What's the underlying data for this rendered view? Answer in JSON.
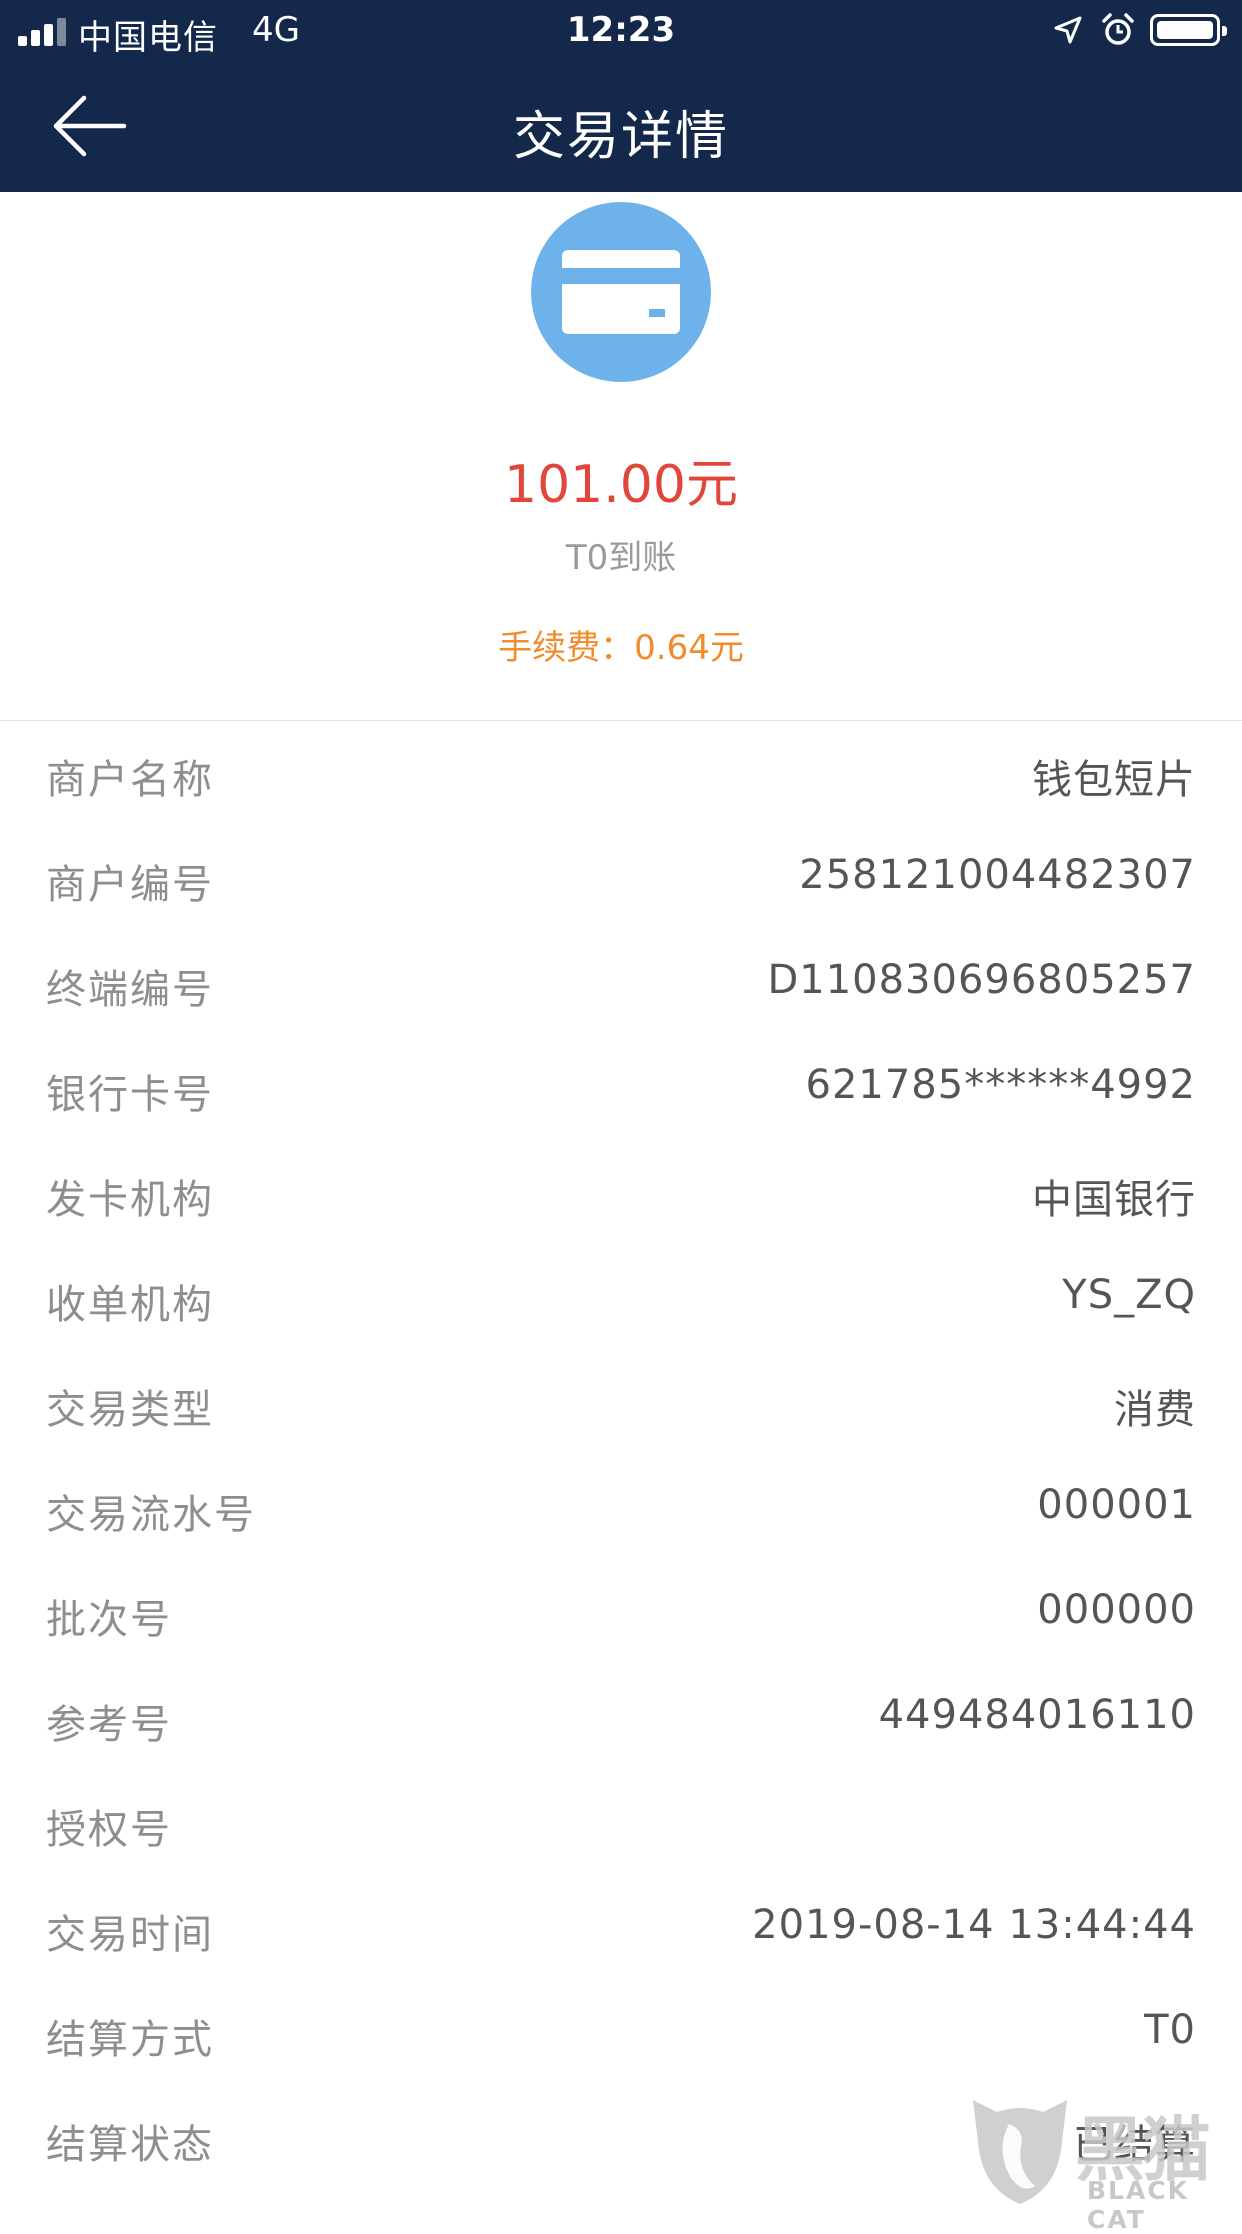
{
  "status_bar": {
    "carrier": "中国电信",
    "network": "4G",
    "time": "12:23"
  },
  "header": {
    "title": "交易详情"
  },
  "summary": {
    "icon": "credit-card-icon",
    "amount": "101.00元",
    "settlement_label": "T0到账",
    "fee": "手续费：0.64元"
  },
  "details": [
    {
      "label": "商户名称",
      "value": "钱包短片"
    },
    {
      "label": "商户编号",
      "value": "258121004482307"
    },
    {
      "label": "终端编号",
      "value": "D110830696805257"
    },
    {
      "label": "银行卡号",
      "value": "621785******4992"
    },
    {
      "label": "发卡机构",
      "value": "中国银行"
    },
    {
      "label": "收单机构",
      "value": "YS_ZQ"
    },
    {
      "label": "交易类型",
      "value": "消费"
    },
    {
      "label": "交易流水号",
      "value": "000001"
    },
    {
      "label": "批次号",
      "value": "000000"
    },
    {
      "label": "参考号",
      "value": "449484016110"
    },
    {
      "label": "授权号",
      "value": ""
    },
    {
      "label": "交易时间",
      "value": "2019-08-14 13:44:44"
    },
    {
      "label": "结算方式",
      "value": "T0"
    },
    {
      "label": "结算状态",
      "value": "已结算"
    }
  ],
  "watermark": {
    "cn": "黑猫",
    "en": "BLACK CAT"
  },
  "colors": {
    "header_bg": "#13284a",
    "amount": "#e0473a",
    "fee": "#f08c2a",
    "icon_circle": "#6eb2eb"
  }
}
